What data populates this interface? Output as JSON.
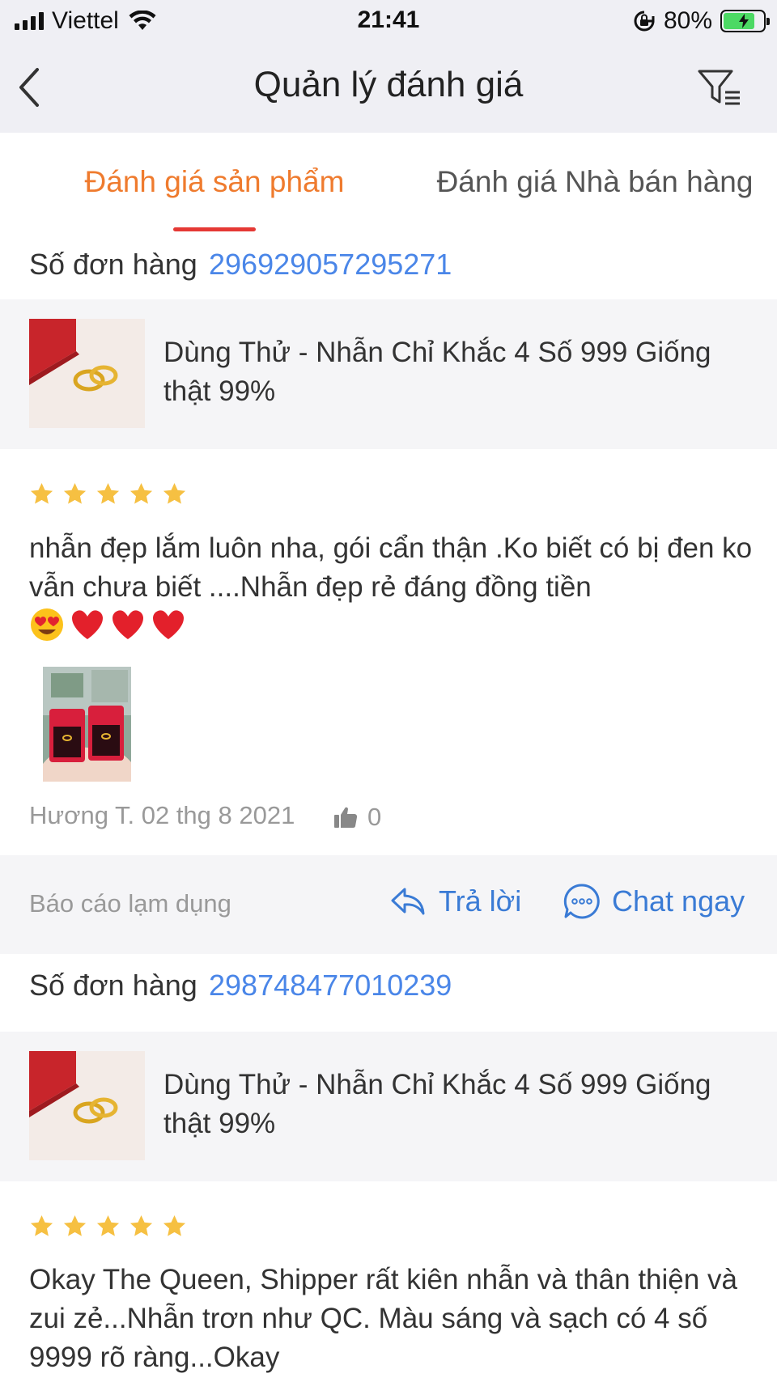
{
  "status_bar": {
    "carrier": "Viettel",
    "time": "21:41",
    "battery": "80%",
    "battery_level": 0.8,
    "icons": [
      "signal-icon",
      "wifi-icon",
      "rotation-lock-icon",
      "battery-charging-icon"
    ]
  },
  "nav": {
    "title": "Quản lý đánh giá",
    "back_icon": "chevron-left-icon",
    "filter_icon": "filter-icon"
  },
  "tabs": [
    {
      "label": "Đánh giá sản phẩm",
      "active": true
    },
    {
      "label": "Đánh giá Nhà bán hàng",
      "active": false
    }
  ],
  "colors": {
    "active_tab": "#ef7b2e",
    "tab_indicator": "#e53935",
    "link_blue": "#4a86e8",
    "action_blue": "#3a7bd5",
    "star": "#f6c042",
    "muted": "#999999"
  },
  "reviews": [
    {
      "order_label": "Số đơn hàng",
      "order_number": "296929057295271",
      "product_name": "Dùng Thử - Nhẫn Chỉ Khắc 4 Số 999 Giống thật 99%",
      "rating": 5,
      "text": "nhẫn đẹp lắm luôn nha, gói cẩn thận .Ko biết có bị đen ko vẫn chưa biết ....Nhẫn đẹp rẻ đáng đồng tiền",
      "emoji": [
        "😍",
        "❤️",
        "❤️",
        "❤️"
      ],
      "author_date": "Hương T. 02 thg 8 2021",
      "likes": "0",
      "report_label": "Báo cáo lạm dụng",
      "reply_label": "Trả lời",
      "chat_label": "Chat ngay"
    },
    {
      "order_label": "Số đơn hàng",
      "order_number": "298748477010239",
      "product_name": "Dùng Thử - Nhẫn Chỉ Khắc 4 Số 999 Giống thật 99%",
      "rating": 5,
      "text": "Okay The Queen, Shipper rất kiên nhẫn và thân thiện và zui zẻ...Nhẫn trơn như QC. Màu sáng và sạch có 4 số 9999 rõ ràng...Okay"
    }
  ]
}
